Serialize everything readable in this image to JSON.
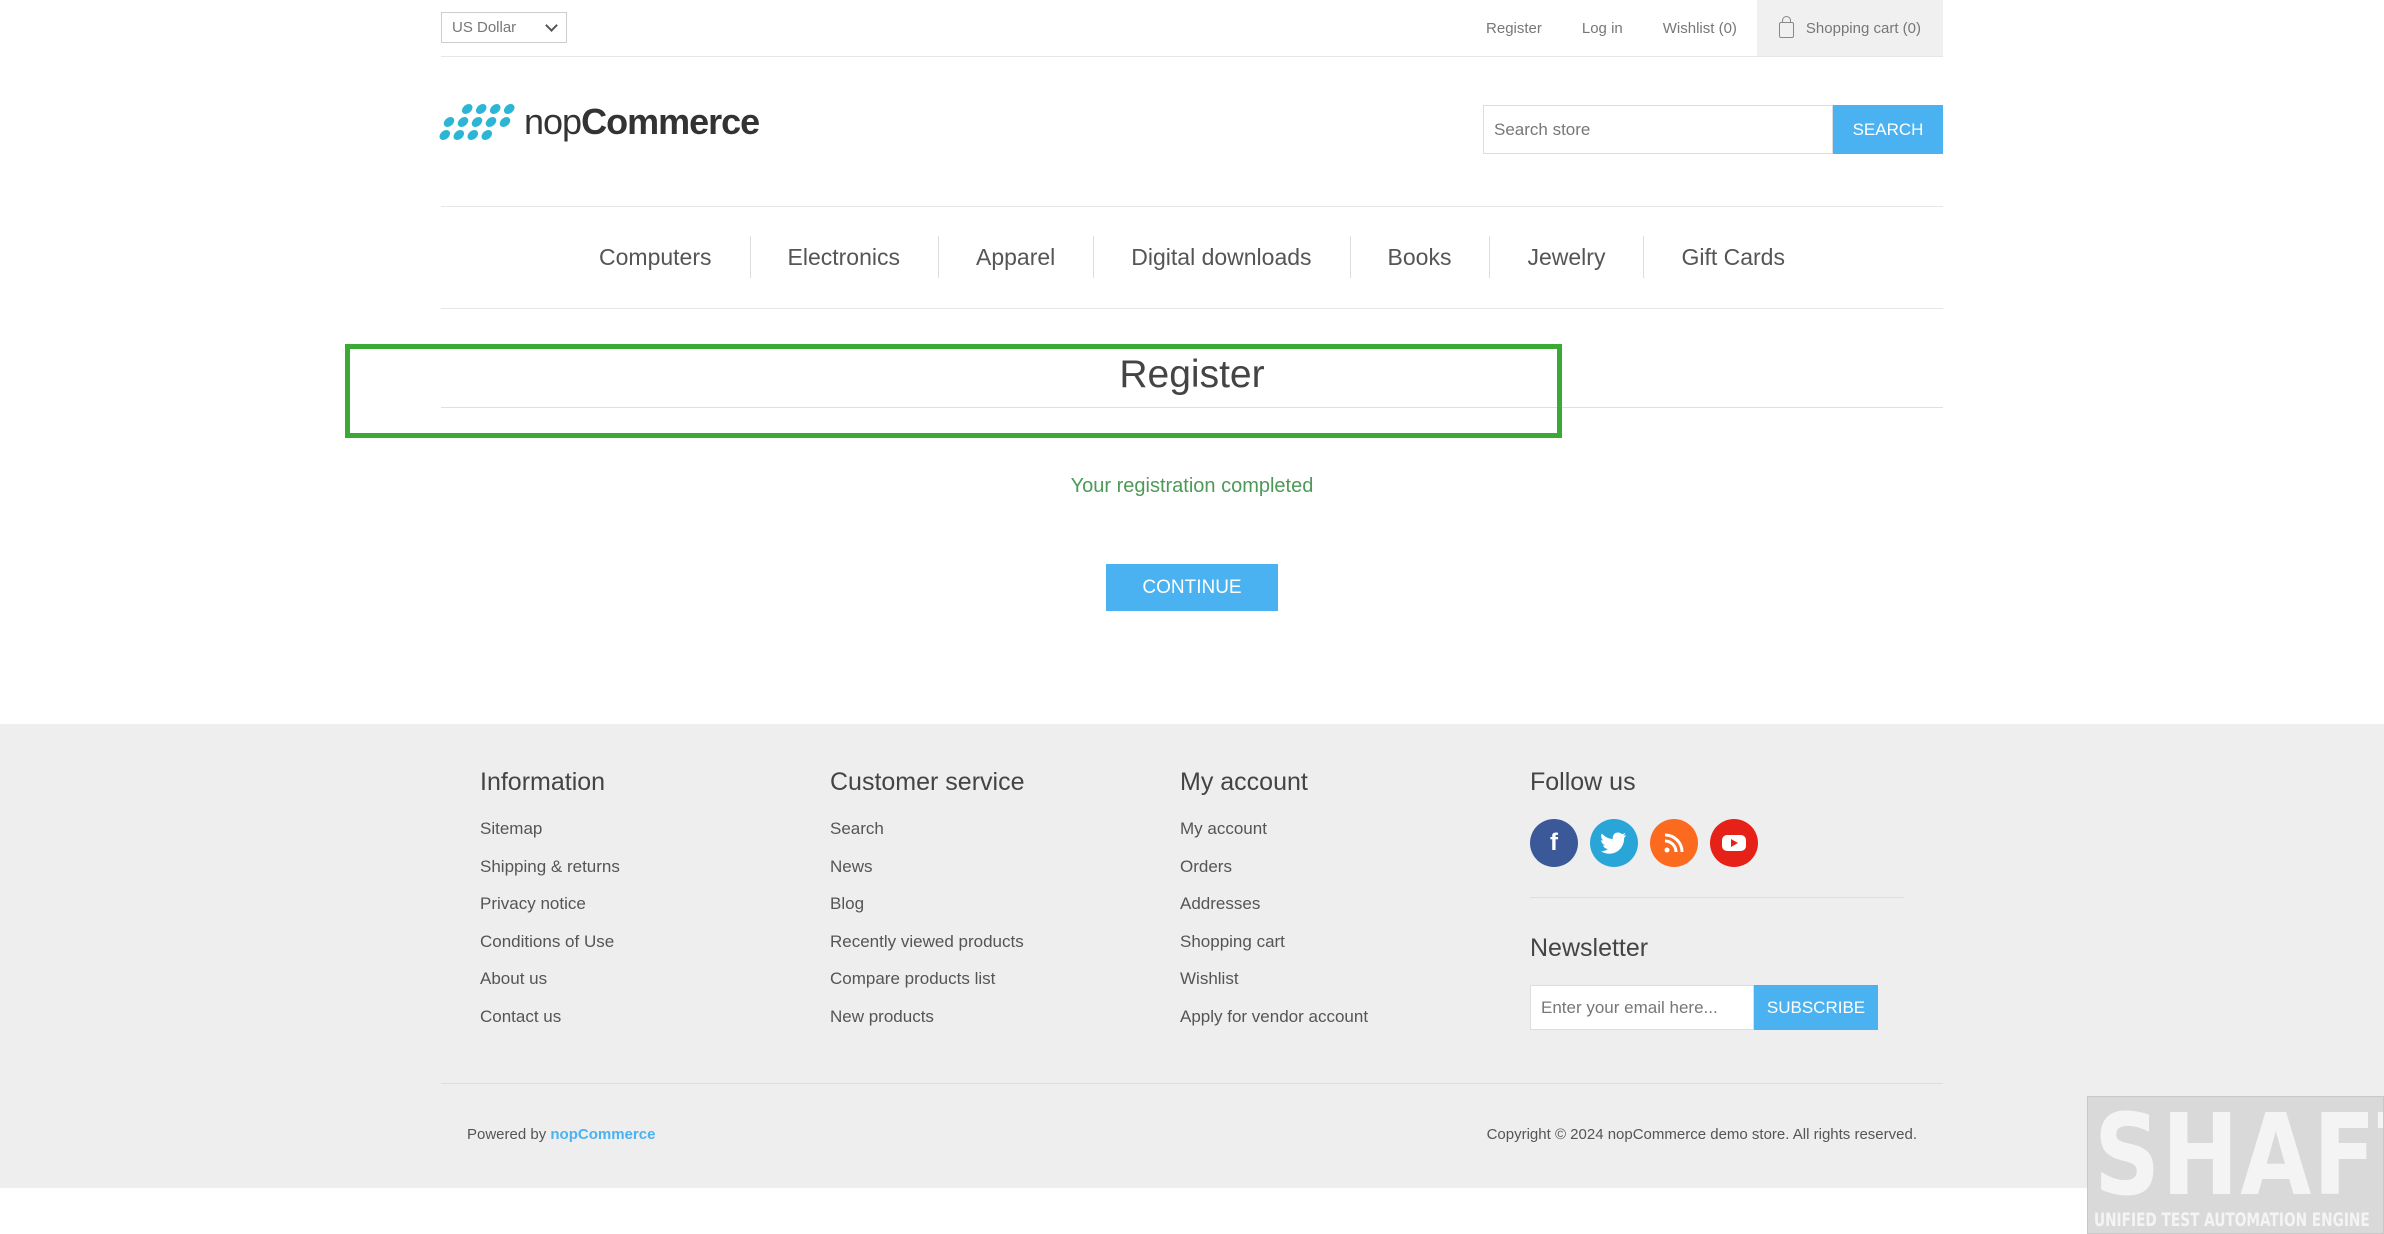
{
  "header": {
    "currency": "US Dollar",
    "links": {
      "register": "Register",
      "login": "Log in",
      "wishlist": "Wishlist (0)",
      "cart": "Shopping cart (0)"
    }
  },
  "logo": {
    "part1": "nop",
    "part2": "Commerce"
  },
  "search": {
    "placeholder": "Search store",
    "button": "SEARCH"
  },
  "nav": {
    "items": [
      "Computers",
      "Electronics",
      "Apparel",
      "Digital downloads",
      "Books",
      "Jewelry",
      "Gift Cards"
    ]
  },
  "page": {
    "title": "Register",
    "result": "Your registration completed",
    "continue": "CONTINUE"
  },
  "footer": {
    "information": {
      "title": "Information",
      "items": [
        "Sitemap",
        "Shipping & returns",
        "Privacy notice",
        "Conditions of Use",
        "About us",
        "Contact us"
      ]
    },
    "customer_service": {
      "title": "Customer service",
      "items": [
        "Search",
        "News",
        "Blog",
        "Recently viewed products",
        "Compare products list",
        "New products"
      ]
    },
    "my_account": {
      "title": "My account",
      "items": [
        "My account",
        "Orders",
        "Addresses",
        "Shopping cart",
        "Wishlist",
        "Apply for vendor account"
      ]
    },
    "follow": {
      "title": "Follow us",
      "icons": [
        "facebook-icon",
        "twitter-icon",
        "rss-icon",
        "youtube-icon"
      ]
    },
    "newsletter": {
      "title": "Newsletter",
      "placeholder": "Enter your email here...",
      "button": "SUBSCRIBE"
    },
    "powered_prefix": "Powered by",
    "powered_link": "nopCommerce",
    "copyright": "Copyright © 2024 nopCommerce demo store. All rights reserved."
  },
  "watermark": {
    "title": "SHAFT",
    "subtitle": "UNIFIED TEST AUTOMATION ENGINE"
  },
  "colors": {
    "accent": "#4ab2f1",
    "success": "#4d9a56",
    "highlight": "#3aaa35"
  }
}
